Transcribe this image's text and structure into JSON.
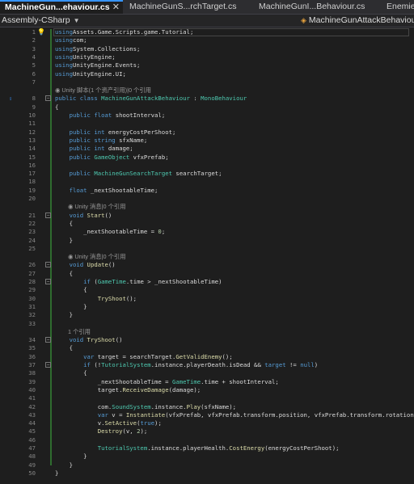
{
  "tabs": [
    {
      "label": "MachineGun...ehaviour.cs",
      "close": "✕",
      "active": true
    },
    {
      "label": "MachineGunS...rchTarget.cs",
      "active": false
    },
    {
      "label": "MachineGunI...Behaviour.cs",
      "active": false
    },
    {
      "label": "Enemies",
      "active": false
    }
  ],
  "navbar": {
    "project": "Assembly-CSharp",
    "class": "MachineGunAttackBehaviour",
    "class_icon": "class-icon"
  },
  "editor": {
    "lens_unity": "Unity 脚本(1 个资产引用)|0 个引用",
    "lens_message": "Unity 消息|0 个引用",
    "lens_refs": "1 个引用",
    "lines": [
      {
        "n": "1",
        "segs": [
          [
            "k",
            "using"
          ],
          [
            "",
            "Assets.Game.Scripts.game.Tutorial;"
          ]
        ]
      },
      {
        "n": "2",
        "segs": [
          [
            "k",
            "using"
          ],
          [
            "",
            "com;"
          ]
        ]
      },
      {
        "n": "3",
        "segs": [
          [
            "k",
            "using"
          ],
          [
            "",
            "System.Collections;"
          ]
        ]
      },
      {
        "n": "4",
        "segs": [
          [
            "k",
            "using"
          ],
          [
            "",
            "UnityEngine;"
          ]
        ]
      },
      {
        "n": "5",
        "segs": [
          [
            "k",
            "using"
          ],
          [
            "",
            "UnityEngine.Events;"
          ]
        ]
      },
      {
        "n": "6",
        "segs": [
          [
            "k",
            "using"
          ],
          [
            "",
            "UnityEngine.UI;"
          ]
        ]
      },
      {
        "n": "7",
        "segs": []
      },
      {
        "lens": "unity"
      },
      {
        "n": "8",
        "segs": [
          [
            "k",
            "public class "
          ],
          [
            "t",
            "MachineGunAttackBehaviour"
          ],
          [
            "",
            " : "
          ],
          [
            "t",
            "MonoBehaviour"
          ]
        ]
      },
      {
        "n": "9",
        "segs": [
          [
            "",
            "{"
          ]
        ]
      },
      {
        "n": "10",
        "segs": [
          [
            "",
            "    "
          ],
          [
            "k",
            "public float "
          ],
          [
            "",
            "shootInterval;"
          ]
        ]
      },
      {
        "n": "11",
        "segs": []
      },
      {
        "n": "12",
        "segs": [
          [
            "",
            "    "
          ],
          [
            "k",
            "public int "
          ],
          [
            "",
            "energyCostPerShoot;"
          ]
        ]
      },
      {
        "n": "13",
        "segs": [
          [
            "",
            "    "
          ],
          [
            "k",
            "public string "
          ],
          [
            "",
            "sfxName;"
          ]
        ]
      },
      {
        "n": "14",
        "segs": [
          [
            "",
            "    "
          ],
          [
            "k",
            "public int "
          ],
          [
            "",
            "damage;"
          ]
        ]
      },
      {
        "n": "15",
        "segs": [
          [
            "",
            "    "
          ],
          [
            "k",
            "public "
          ],
          [
            "t",
            "GameObject "
          ],
          [
            "",
            "vfxPrefab;"
          ]
        ]
      },
      {
        "n": "16",
        "segs": []
      },
      {
        "n": "17",
        "segs": [
          [
            "",
            "    "
          ],
          [
            "k",
            "public "
          ],
          [
            "t",
            "MachineGunSearchTarget "
          ],
          [
            "",
            "searchTarget;"
          ]
        ]
      },
      {
        "n": "18",
        "segs": []
      },
      {
        "n": "19",
        "segs": [
          [
            "",
            "    "
          ],
          [
            "k",
            "float "
          ],
          [
            "",
            "_nextShootableTime;"
          ]
        ]
      },
      {
        "n": "20",
        "segs": []
      },
      {
        "lens": "message"
      },
      {
        "n": "21",
        "segs": [
          [
            "",
            "    "
          ],
          [
            "k",
            "void "
          ],
          [
            "m",
            "Start"
          ],
          [
            "",
            "()"
          ]
        ]
      },
      {
        "n": "22",
        "segs": [
          [
            "",
            "    {"
          ]
        ]
      },
      {
        "n": "23",
        "segs": [
          [
            "",
            "        _nextShootableTime = "
          ],
          [
            "n",
            "0"
          ],
          [
            "",
            ";"
          ]
        ]
      },
      {
        "n": "24",
        "segs": [
          [
            "",
            "    }"
          ]
        ]
      },
      {
        "n": "25",
        "segs": []
      },
      {
        "lens": "message"
      },
      {
        "n": "26",
        "segs": [
          [
            "",
            "    "
          ],
          [
            "k",
            "void "
          ],
          [
            "m",
            "Update"
          ],
          [
            "",
            "()"
          ]
        ]
      },
      {
        "n": "27",
        "segs": [
          [
            "",
            "    {"
          ]
        ]
      },
      {
        "n": "28",
        "segs": [
          [
            "",
            "        "
          ],
          [
            "k",
            "if "
          ],
          [
            "",
            "("
          ],
          [
            "t",
            "GameTime"
          ],
          [
            "",
            ".time > _nextShootableTime)"
          ]
        ]
      },
      {
        "n": "29",
        "segs": [
          [
            "",
            "        {"
          ]
        ]
      },
      {
        "n": "30",
        "segs": [
          [
            "",
            "            "
          ],
          [
            "m",
            "TryShoot"
          ],
          [
            "",
            "();"
          ]
        ]
      },
      {
        "n": "31",
        "segs": [
          [
            "",
            "        }"
          ]
        ]
      },
      {
        "n": "32",
        "segs": [
          [
            "",
            "    }"
          ]
        ]
      },
      {
        "n": "33",
        "segs": []
      },
      {
        "lens": "refs"
      },
      {
        "n": "34",
        "segs": [
          [
            "",
            "    "
          ],
          [
            "k",
            "void "
          ],
          [
            "m",
            "TryShoot"
          ],
          [
            "",
            "()"
          ]
        ]
      },
      {
        "n": "35",
        "segs": [
          [
            "",
            "    {"
          ]
        ]
      },
      {
        "n": "36",
        "segs": [
          [
            "",
            "        "
          ],
          [
            "k",
            "var "
          ],
          [
            "",
            "target = searchTarget."
          ],
          [
            "m",
            "GetValidEnemy"
          ],
          [
            "",
            "();"
          ]
        ]
      },
      {
        "n": "37",
        "segs": [
          [
            "",
            "        "
          ],
          [
            "k",
            "if "
          ],
          [
            "",
            "(!"
          ],
          [
            "t",
            "TutorialSystem"
          ],
          [
            "",
            ".instance.playerDeath.isDead && "
          ],
          [
            "k",
            "target "
          ],
          [
            "",
            "!= "
          ],
          [
            "k",
            "null"
          ],
          [
            "",
            ")"
          ]
        ]
      },
      {
        "n": "38",
        "segs": [
          [
            "",
            "        {"
          ]
        ]
      },
      {
        "n": "39",
        "segs": [
          [
            "",
            "            _nextShootableTime = "
          ],
          [
            "t",
            "GameTime"
          ],
          [
            "",
            ".time + shootInterval;"
          ]
        ]
      },
      {
        "n": "40",
        "segs": [
          [
            "",
            "            target."
          ],
          [
            "m",
            "ReceiveDamage"
          ],
          [
            "",
            "(damage);"
          ]
        ]
      },
      {
        "n": "41",
        "segs": []
      },
      {
        "n": "42",
        "segs": [
          [
            "",
            "            com."
          ],
          [
            "t",
            "SoundSystem"
          ],
          [
            "",
            ".instance."
          ],
          [
            "m",
            "Play"
          ],
          [
            "",
            "(sfxName);"
          ]
        ]
      },
      {
        "n": "43",
        "segs": [
          [
            "",
            "            "
          ],
          [
            "k",
            "var "
          ],
          [
            "",
            "v = "
          ],
          [
            "m",
            "Instantiate"
          ],
          [
            "",
            "(vfxPrefab, vfxPrefab.transform.position, vfxPrefab.transform.rotation);"
          ]
        ]
      },
      {
        "n": "44",
        "segs": [
          [
            "",
            "            v."
          ],
          [
            "m",
            "SetActive"
          ],
          [
            "",
            "("
          ],
          [
            "k",
            "true"
          ],
          [
            "",
            ");"
          ]
        ]
      },
      {
        "n": "45",
        "segs": [
          [
            "",
            "            "
          ],
          [
            "m",
            "Destroy"
          ],
          [
            "",
            "(v, "
          ],
          [
            "n",
            "2"
          ],
          [
            "",
            ");"
          ]
        ]
      },
      {
        "n": "46",
        "segs": []
      },
      {
        "n": "47",
        "segs": [
          [
            "",
            "            "
          ],
          [
            "t",
            "TutorialSystem"
          ],
          [
            "",
            ".instance.playerHealth."
          ],
          [
            "m",
            "CostEnergy"
          ],
          [
            "",
            "(energyCostPerShoot);"
          ]
        ]
      },
      {
        "n": "48",
        "segs": [
          [
            "",
            "        }"
          ]
        ]
      },
      {
        "n": "49",
        "segs": [
          [
            "",
            "    }"
          ]
        ]
      },
      {
        "n": "50",
        "segs": [
          [
            "",
            "}"
          ]
        ]
      }
    ]
  }
}
